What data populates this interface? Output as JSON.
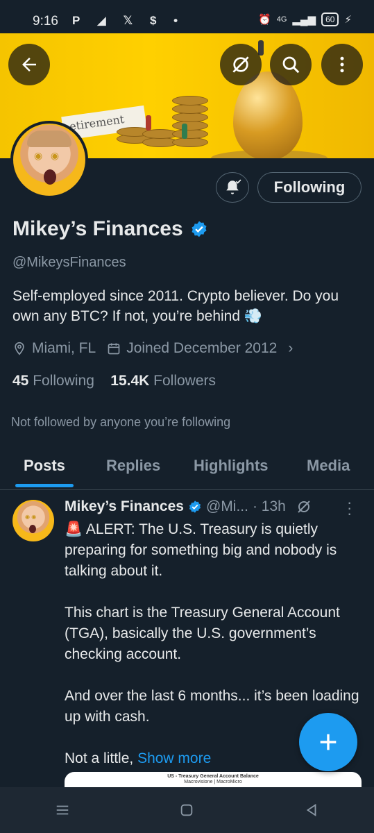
{
  "status_bar": {
    "time": "9:16",
    "app_icons": "P ◢ 𝕏 $ •",
    "network": "4G",
    "battery": "60"
  },
  "profile": {
    "name": "Mikey’s Finances",
    "handle": "@MikeysFinances",
    "bio": "Self-employed since 2011. Crypto believer. Do you own any BTC? If not, you’re behind 💨",
    "location": "Miami, FL",
    "joined": "Joined December 2012",
    "following_count": "45",
    "following_label": "Following",
    "followers_count": "15.4K",
    "followers_label": "Followers",
    "not_followed_text": "Not followed by anyone you’re following",
    "follow_button": "Following",
    "banner_sign_text": "etirement"
  },
  "tabs": [
    "Posts",
    "Replies",
    "Highlights",
    "Media"
  ],
  "post": {
    "author": "Mikey’s Finances",
    "handle": "@Mi...",
    "time": "· 13h",
    "line1": "🚨 ALERT: The U.S. Treasury is quietly preparing for something big and nobody is talking about it.",
    "line2": "This chart is the Treasury General Account (TGA), basically the U.S. government’s checking account.",
    "line3": "And over the last 6 months... it’s been loading up with cash.",
    "line4": "Not a little,",
    "show_more": "Show more",
    "media_title": "US - Treasury General Account Balance",
    "media_subtitle": "Macrovisione | MacroMicro"
  },
  "colors": {
    "background": "#15202b",
    "accent": "#1d9bf0",
    "secondary_text": "#8b98a5"
  }
}
